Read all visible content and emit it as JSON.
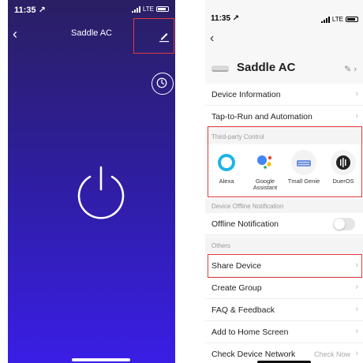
{
  "left": {
    "status_time": "11:35 ↗",
    "network": "LTE",
    "back": "‹",
    "title": "Saddle AC"
  },
  "right": {
    "status_time": "11:35 ↗",
    "network": "LTE",
    "back": "‹",
    "device_name": "Saddle AC",
    "rows": {
      "device_info": "Device Information",
      "tap_to_run": "Tap-to-Run and Automation",
      "offline_notification": "Offline Notification",
      "share_device": "Share Device",
      "create_group": "Create Group",
      "faq": "FAQ & Feedback",
      "add_home": "Add to Home Screen",
      "check_network": "Check Device Network",
      "check_now": "Check Now"
    },
    "sections": {
      "third_party": "Third-party Control",
      "offline": "Device Offline Notification",
      "others": "Others"
    },
    "third_party": [
      {
        "label": "Alexa",
        "icon": "alexa-icon"
      },
      {
        "label": "Google Assistant",
        "icon": "google-assistant-icon"
      },
      {
        "label": "Tmall Genie",
        "icon": "tmall-genie-icon"
      },
      {
        "label": "DuerOS",
        "icon": "dueros-icon"
      }
    ]
  },
  "colors": {
    "highlight": "#e03b3b",
    "alexa": "#1fb4e6",
    "google_blue": "#4285f4",
    "google_red": "#ea4335",
    "google_yellow": "#fbbc05",
    "google_green": "#34a853",
    "tmall": "#6a8fe0"
  }
}
